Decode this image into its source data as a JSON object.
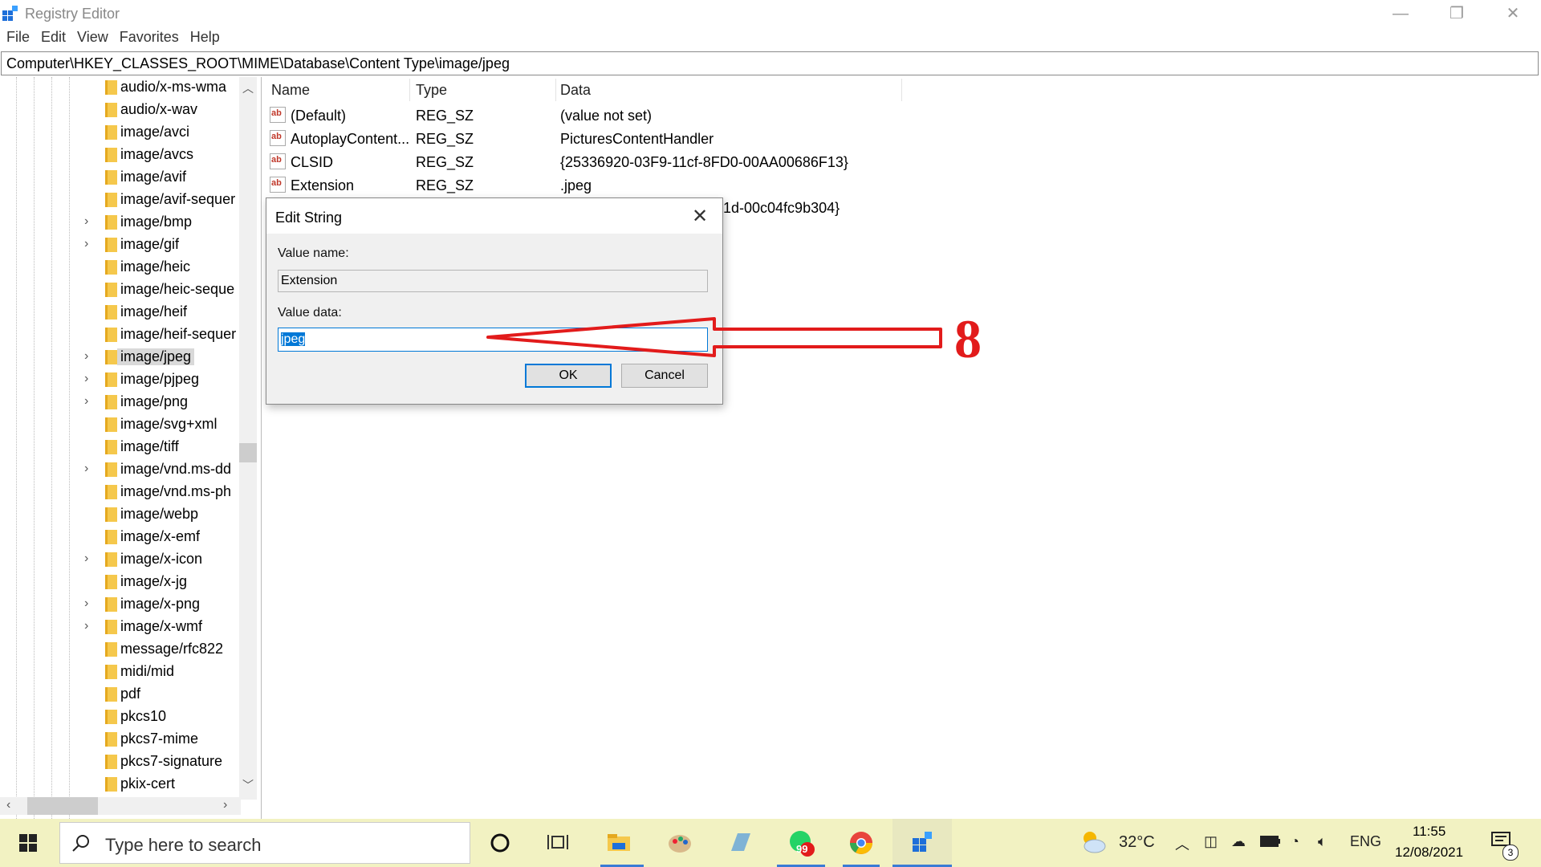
{
  "window": {
    "title": "Registry Editor",
    "minimize_glyph": "—",
    "restore_glyph": "❐",
    "close_glyph": "✕"
  },
  "menu": [
    "File",
    "Edit",
    "View",
    "Favorites",
    "Help"
  ],
  "address_path": "Computer\\HKEY_CLASSES_ROOT\\MIME\\Database\\Content Type\\image/jpeg",
  "tree": {
    "items": [
      {
        "label": "audio/x-ms-wma",
        "expandable": false,
        "selected": false
      },
      {
        "label": "audio/x-wav",
        "expandable": false,
        "selected": false
      },
      {
        "label": "image/avci",
        "expandable": false,
        "selected": false
      },
      {
        "label": "image/avcs",
        "expandable": false,
        "selected": false
      },
      {
        "label": "image/avif",
        "expandable": false,
        "selected": false
      },
      {
        "label": "image/avif-sequer",
        "expandable": false,
        "selected": false
      },
      {
        "label": "image/bmp",
        "expandable": true,
        "selected": false
      },
      {
        "label": "image/gif",
        "expandable": true,
        "selected": false
      },
      {
        "label": "image/heic",
        "expandable": false,
        "selected": false
      },
      {
        "label": "image/heic-seque",
        "expandable": false,
        "selected": false
      },
      {
        "label": "image/heif",
        "expandable": false,
        "selected": false
      },
      {
        "label": "image/heif-sequer",
        "expandable": false,
        "selected": false
      },
      {
        "label": "image/jpeg",
        "expandable": true,
        "selected": true
      },
      {
        "label": "image/pjpeg",
        "expandable": true,
        "selected": false
      },
      {
        "label": "image/png",
        "expandable": true,
        "selected": false
      },
      {
        "label": "image/svg+xml",
        "expandable": false,
        "selected": false
      },
      {
        "label": "image/tiff",
        "expandable": false,
        "selected": false
      },
      {
        "label": "image/vnd.ms-dd",
        "expandable": true,
        "selected": false
      },
      {
        "label": "image/vnd.ms-ph",
        "expandable": false,
        "selected": false
      },
      {
        "label": "image/webp",
        "expandable": false,
        "selected": false
      },
      {
        "label": "image/x-emf",
        "expandable": false,
        "selected": false
      },
      {
        "label": "image/x-icon",
        "expandable": true,
        "selected": false
      },
      {
        "label": "image/x-jg",
        "expandable": false,
        "selected": false
      },
      {
        "label": "image/x-png",
        "expandable": true,
        "selected": false
      },
      {
        "label": "image/x-wmf",
        "expandable": true,
        "selected": false
      },
      {
        "label": "message/rfc822",
        "expandable": false,
        "selected": false
      },
      {
        "label": "midi/mid",
        "expandable": false,
        "selected": false
      },
      {
        "label": "pdf",
        "expandable": false,
        "selected": false
      },
      {
        "label": "pkcs10",
        "expandable": false,
        "selected": false
      },
      {
        "label": "pkcs7-mime",
        "expandable": false,
        "selected": false
      },
      {
        "label": "pkcs7-signature",
        "expandable": false,
        "selected": false
      },
      {
        "label": "pkix-cert",
        "expandable": false,
        "selected": false
      }
    ]
  },
  "list": {
    "headers": {
      "name": "Name",
      "type": "Type",
      "data": "Data"
    },
    "rows": [
      {
        "name": "(Default)",
        "type": "REG_SZ",
        "data": "(value not set)"
      },
      {
        "name": "AutoplayContent...",
        "type": "REG_SZ",
        "data": "PicturesContentHandler"
      },
      {
        "name": "CLSID",
        "type": "REG_SZ",
        "data": "{25336920-03F9-11cf-8FD0-00AA00686F13}"
      },
      {
        "name": "Extension",
        "type": "REG_SZ",
        "data": ".jpeg"
      }
    ],
    "partial_row_data": "1d-00c04fc9b304}"
  },
  "dialog": {
    "title": "Edit String",
    "value_name_label": "Value name:",
    "value_name": "Extension",
    "value_data_label": "Value data:",
    "value_data": "jpeg",
    "ok_label": "OK",
    "cancel_label": "Cancel",
    "close_glyph": "✕"
  },
  "annotation": {
    "number": "8",
    "color": "#e21b1b"
  },
  "taskbar": {
    "search_placeholder": "Type here to search",
    "whatsapp_badge": "99",
    "temperature": "32°C",
    "language": "ENG",
    "time": "11:55",
    "date": "12/08/2021",
    "notification_count": "3"
  },
  "colors": {
    "accent": "#0078d7",
    "annotation_red": "#e21b1b",
    "taskbar_bg": "#f2f2c2"
  }
}
